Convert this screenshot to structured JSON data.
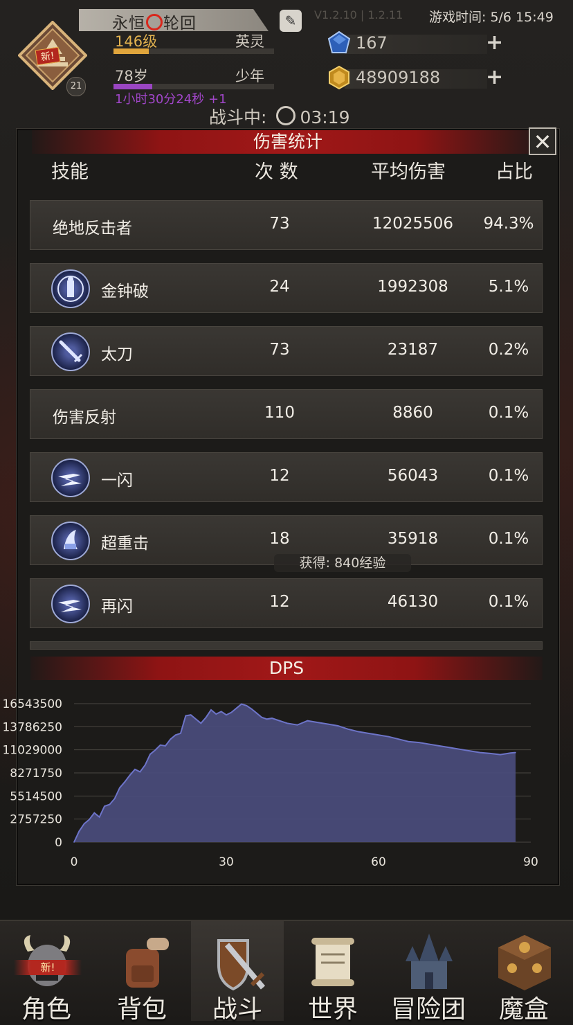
{
  "header": {
    "player_name_part1": "永恒",
    "player_name_part2": "轮回",
    "avatar_level": "21",
    "avatar_badge": "新!",
    "level_text": "146级",
    "rank_text": "英灵",
    "level_progress": 0.22,
    "age_text": "78岁",
    "age_rank": "少年",
    "age_progress": 0.24,
    "age_timer": "1小时30分24秒 +1",
    "version_text": "V1.2.10 | 1.2.11",
    "game_time": "游戏时间: 5/6 15:49",
    "gems": "167",
    "gold": "48909188",
    "battle_status_label": "战斗中:",
    "battle_timer": "03:19"
  },
  "panel": {
    "title": "伤害统计",
    "columns": {
      "skill": "技能",
      "count": "次 数",
      "avg": "平均伤害",
      "pct": "占比"
    },
    "rows": [
      {
        "name": "绝地反击者",
        "count": "73",
        "avg": "12025506",
        "pct": "94.3%",
        "icon": ""
      },
      {
        "name": "金钟破",
        "count": "24",
        "avg": "1992308",
        "pct": "5.1%",
        "icon": "golden-bell-icon"
      },
      {
        "name": "太刀",
        "count": "73",
        "avg": "23187",
        "pct": "0.2%",
        "icon": "katana-icon"
      },
      {
        "name": "伤害反射",
        "count": "110",
        "avg": "8860",
        "pct": "0.1%",
        "icon": ""
      },
      {
        "name": "一闪",
        "count": "12",
        "avg": "56043",
        "pct": "0.1%",
        "icon": "flash-strike-icon"
      },
      {
        "name": "超重击",
        "count": "18",
        "avg": "35918",
        "pct": "0.1%",
        "icon": "heavy-strike-icon"
      },
      {
        "name": "再闪",
        "count": "12",
        "avg": "46130",
        "pct": "0.1%",
        "icon": "flash-strike-icon"
      }
    ],
    "exp_toast": "获得: 840经验",
    "dps_title": "DPS"
  },
  "chart_data": {
    "type": "area",
    "title": "DPS",
    "xlabel": "",
    "ylabel": "",
    "xlim": [
      0,
      90
    ],
    "ylim": [
      0,
      16543500
    ],
    "x_ticks": [
      "0",
      "30",
      "60",
      "90"
    ],
    "y_ticks": [
      "16543500",
      "13786250",
      "11029000",
      "8271750",
      "5514500",
      "2757250",
      "0"
    ],
    "grid": true,
    "fill_color": "#4b4e7e",
    "line_color": "#6d74c8",
    "series": [
      {
        "x": [
          0,
          1,
          2,
          3,
          4,
          5,
          6,
          7,
          8,
          9,
          10,
          11,
          12,
          13,
          14,
          15,
          16,
          17,
          18,
          19,
          20,
          21,
          22,
          23,
          24,
          25,
          26,
          27,
          28,
          29,
          30,
          31,
          32,
          33,
          34,
          35,
          36,
          37,
          38,
          39,
          40,
          42,
          44,
          46,
          48,
          50,
          52,
          54,
          56,
          58,
          60,
          62,
          64,
          66,
          68,
          70,
          72,
          74,
          76,
          78,
          80,
          82,
          84,
          86,
          87
        ],
        "y": [
          0,
          1300000,
          2200000,
          2700000,
          3500000,
          3000000,
          4300000,
          4500000,
          5200000,
          6500000,
          7200000,
          8000000,
          8700000,
          8400000,
          9200000,
          10500000,
          11000000,
          11600000,
          11500000,
          12300000,
          12800000,
          13000000,
          15100000,
          15200000,
          14700000,
          14200000,
          14900000,
          15800000,
          15300000,
          15600000,
          15200000,
          15500000,
          16000000,
          16500000,
          16300000,
          15900000,
          15400000,
          14900000,
          14700000,
          14800000,
          14600000,
          14200000,
          14000000,
          14500000,
          14300000,
          14100000,
          13900000,
          13500000,
          13200000,
          13000000,
          12800000,
          12600000,
          12300000,
          12000000,
          11900000,
          11700000,
          11500000,
          11300000,
          11100000,
          10900000,
          10700000,
          10600000,
          10450000,
          10650000,
          10700000
        ]
      }
    ]
  },
  "nav": {
    "items": [
      {
        "label": "角色",
        "badge": "新!"
      },
      {
        "label": "背包"
      },
      {
        "label": "战斗"
      },
      {
        "label": "世界"
      },
      {
        "label": "冒险团"
      },
      {
        "label": "魔盒"
      }
    ]
  }
}
